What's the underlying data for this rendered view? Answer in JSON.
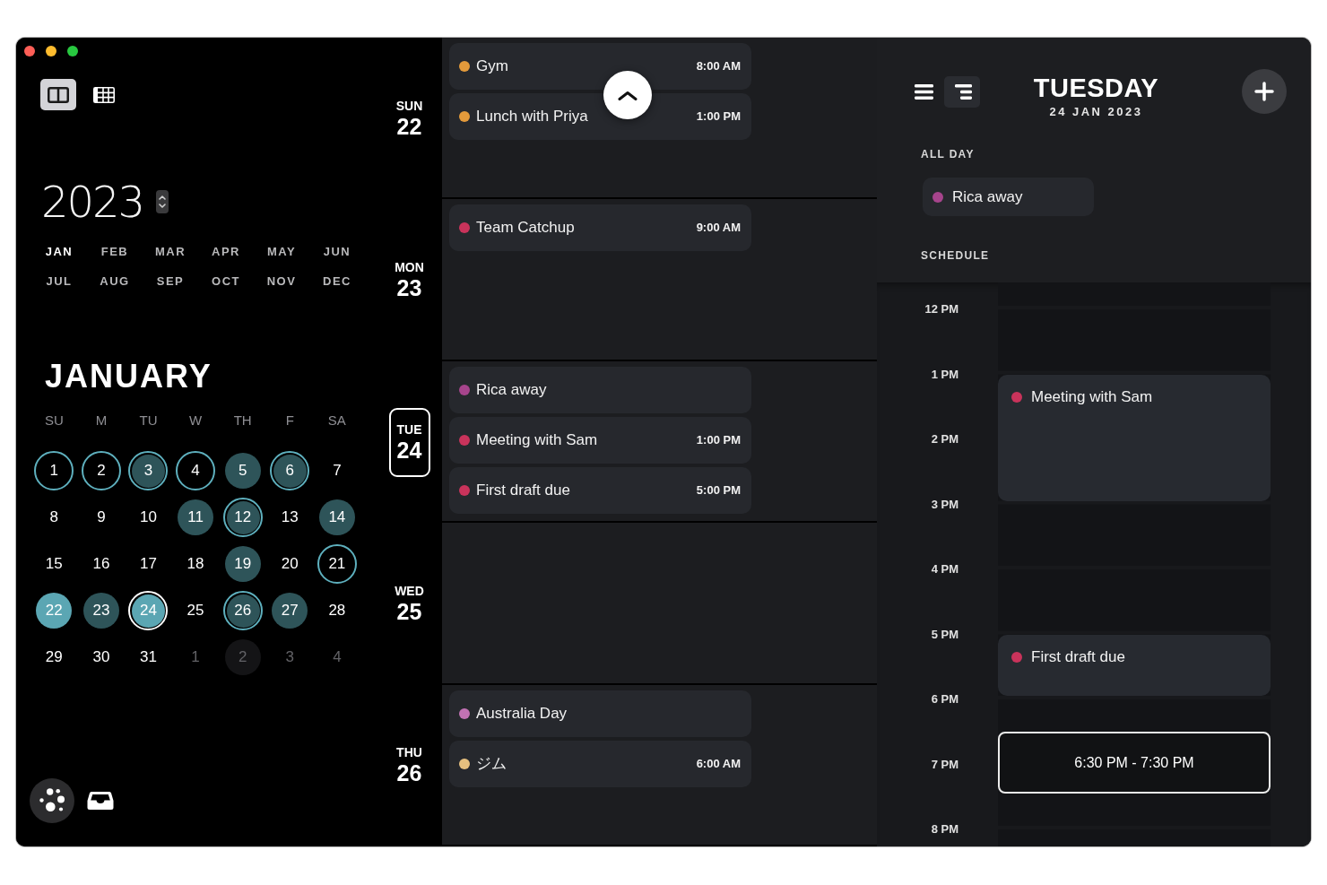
{
  "sidebar": {
    "view_modes": [
      {
        "kind": "split",
        "selected": true
      },
      {
        "kind": "grid",
        "selected": false
      }
    ],
    "year": "2023",
    "months": [
      {
        "label": "JAN",
        "selected": true
      },
      {
        "label": "FEB",
        "selected": false
      },
      {
        "label": "MAR",
        "selected": false
      },
      {
        "label": "APR",
        "selected": false
      },
      {
        "label": "MAY",
        "selected": false
      },
      {
        "label": "JUN",
        "selected": false
      },
      {
        "label": "JUL",
        "selected": false
      },
      {
        "label": "AUG",
        "selected": false
      },
      {
        "label": "SEP",
        "selected": false
      },
      {
        "label": "OCT",
        "selected": false
      },
      {
        "label": "NOV",
        "selected": false
      },
      {
        "label": "DEC",
        "selected": false
      }
    ],
    "month_title": "JANUARY",
    "weekdays": [
      "SU",
      "M",
      "TU",
      "W",
      "TH",
      "F",
      "SA"
    ],
    "days": [
      {
        "label": "1",
        "filled": false,
        "ringed": true,
        "highlighted": false,
        "selected": false,
        "other_month": false
      },
      {
        "label": "2",
        "filled": false,
        "ringed": true,
        "highlighted": false,
        "selected": false,
        "other_month": false
      },
      {
        "label": "3",
        "filled": true,
        "ringed": true,
        "highlighted": false,
        "selected": false,
        "other_month": false
      },
      {
        "label": "4",
        "filled": false,
        "ringed": true,
        "highlighted": false,
        "selected": false,
        "other_month": false
      },
      {
        "label": "5",
        "filled": true,
        "ringed": false,
        "highlighted": false,
        "selected": false,
        "other_month": false
      },
      {
        "label": "6",
        "filled": true,
        "ringed": true,
        "highlighted": false,
        "selected": false,
        "other_month": false
      },
      {
        "label": "7",
        "filled": false,
        "ringed": false,
        "highlighted": false,
        "selected": false,
        "other_month": false
      },
      {
        "label": "8",
        "filled": false,
        "ringed": false,
        "highlighted": false,
        "selected": false,
        "other_month": false
      },
      {
        "label": "9",
        "filled": false,
        "ringed": false,
        "highlighted": false,
        "selected": false,
        "other_month": false
      },
      {
        "label": "10",
        "filled": false,
        "ringed": false,
        "highlighted": false,
        "selected": false,
        "other_month": false
      },
      {
        "label": "11",
        "filled": true,
        "ringed": false,
        "highlighted": false,
        "selected": false,
        "other_month": false
      },
      {
        "label": "12",
        "filled": true,
        "ringed": true,
        "highlighted": false,
        "selected": false,
        "other_month": false
      },
      {
        "label": "13",
        "filled": false,
        "ringed": false,
        "highlighted": false,
        "selected": false,
        "other_month": false
      },
      {
        "label": "14",
        "filled": true,
        "ringed": false,
        "highlighted": false,
        "selected": false,
        "other_month": false
      },
      {
        "label": "15",
        "filled": false,
        "ringed": false,
        "highlighted": false,
        "selected": false,
        "other_month": false
      },
      {
        "label": "16",
        "filled": false,
        "ringed": false,
        "highlighted": false,
        "selected": false,
        "other_month": false
      },
      {
        "label": "17",
        "filled": false,
        "ringed": false,
        "highlighted": false,
        "selected": false,
        "other_month": false
      },
      {
        "label": "18",
        "filled": false,
        "ringed": false,
        "highlighted": false,
        "selected": false,
        "other_month": false
      },
      {
        "label": "19",
        "filled": true,
        "ringed": false,
        "highlighted": false,
        "selected": false,
        "other_month": false
      },
      {
        "label": "20",
        "filled": false,
        "ringed": false,
        "highlighted": false,
        "selected": false,
        "other_month": false
      },
      {
        "label": "21",
        "filled": false,
        "ringed": true,
        "highlighted": false,
        "selected": false,
        "other_month": false
      },
      {
        "label": "22",
        "filled": false,
        "ringed": false,
        "highlighted": true,
        "selected": false,
        "other_month": false
      },
      {
        "label": "23",
        "filled": true,
        "ringed": false,
        "highlighted": false,
        "selected": false,
        "other_month": false
      },
      {
        "label": "24",
        "filled": false,
        "ringed": false,
        "highlighted": true,
        "selected": true,
        "other_month": false
      },
      {
        "label": "25",
        "filled": false,
        "ringed": false,
        "highlighted": false,
        "selected": false,
        "other_month": false
      },
      {
        "label": "26",
        "filled": true,
        "ringed": true,
        "highlighted": false,
        "selected": false,
        "other_month": false
      },
      {
        "label": "27",
        "filled": true,
        "ringed": false,
        "highlighted": false,
        "selected": false,
        "other_month": false
      },
      {
        "label": "28",
        "filled": false,
        "ringed": false,
        "highlighted": false,
        "selected": false,
        "other_month": false
      },
      {
        "label": "29",
        "filled": false,
        "ringed": false,
        "highlighted": false,
        "selected": false,
        "other_month": false
      },
      {
        "label": "30",
        "filled": false,
        "ringed": false,
        "highlighted": false,
        "selected": false,
        "other_month": false
      },
      {
        "label": "31",
        "filled": false,
        "ringed": false,
        "highlighted": false,
        "selected": false,
        "other_month": false
      },
      {
        "label": "1",
        "filled": false,
        "ringed": false,
        "highlighted": false,
        "selected": false,
        "other_month": true
      },
      {
        "label": "2",
        "filled": true,
        "ringed": false,
        "highlighted": false,
        "selected": false,
        "other_month": true
      },
      {
        "label": "3",
        "filled": false,
        "ringed": false,
        "highlighted": false,
        "selected": false,
        "other_month": true
      },
      {
        "label": "4",
        "filled": false,
        "ringed": false,
        "highlighted": false,
        "selected": false,
        "other_month": true
      }
    ]
  },
  "agenda": {
    "days": [
      {
        "weekday": "SUN",
        "date": "22",
        "selected": false,
        "events": [
          {
            "title": "Gym",
            "time": "8:00 AM",
            "color": "#e39a3b"
          },
          {
            "title": "Lunch with Priya",
            "time": "1:00 PM",
            "color": "#e39a3b"
          }
        ]
      },
      {
        "weekday": "MON",
        "date": "23",
        "selected": false,
        "events": [
          {
            "title": "Team Catchup",
            "time": "9:00 AM",
            "color": "#c9335b"
          }
        ]
      },
      {
        "weekday": "TUE",
        "date": "24",
        "selected": true,
        "events": [
          {
            "title": "Rica away",
            "color": "#a6448c"
          },
          {
            "title": "Meeting with Sam",
            "time": "1:00 PM",
            "color": "#c9335b"
          },
          {
            "title": "First draft due",
            "time": "5:00 PM",
            "color": "#c9335b"
          }
        ]
      },
      {
        "weekday": "WED",
        "date": "25",
        "selected": false
      },
      {
        "weekday": "THU",
        "date": "26",
        "selected": false,
        "events": [
          {
            "title": "Australia Day",
            "color": "#c272b4"
          },
          {
            "title": "ジム",
            "time": "6:00 AM",
            "color": "#e6c07f"
          }
        ]
      }
    ]
  },
  "day_view": {
    "layouts": [
      {
        "kind": "list",
        "selected": false
      },
      {
        "kind": "timeline",
        "selected": true
      }
    ],
    "title": "TUESDAY",
    "date": "24 JAN 2023",
    "all_day_label": "ALL DAY",
    "all_day": [
      {
        "title": "Rica away",
        "color": "#a6448c"
      }
    ],
    "schedule_label": "SCHEDULE",
    "hours": [
      {
        "label": "12 PM"
      },
      {
        "label": "1 PM",
        "blocks": [
          {
            "kind": "twohour",
            "title": "Meeting with Sam",
            "color": "#c9335b"
          }
        ]
      },
      {
        "label": "2 PM"
      },
      {
        "label": "3 PM"
      },
      {
        "label": "4 PM"
      },
      {
        "label": "5 PM",
        "blocks": [
          {
            "kind": "onehour",
            "title": "First draft due",
            "color": "#c9335b"
          }
        ]
      },
      {
        "label": "6 PM",
        "blocks": [
          {
            "kind": "selection",
            "range": "6:30 PM - 7:30 PM"
          }
        ]
      },
      {
        "label": "7 PM"
      },
      {
        "label": "8 PM"
      }
    ]
  }
}
